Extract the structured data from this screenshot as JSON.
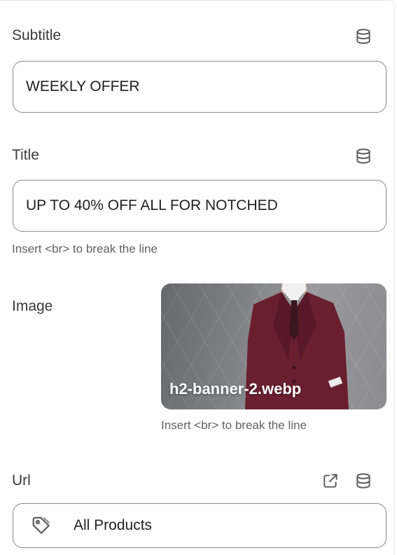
{
  "subtitle": {
    "label": "Subtitle",
    "value": "WEEKLY OFFER",
    "icon": "database-icon"
  },
  "title": {
    "label": "Title",
    "value": "UP TO 40%  OFF ALL FOR NOTCHED",
    "help": "Insert <br> to break the line",
    "icon": "database-icon"
  },
  "image": {
    "label": "Image",
    "filename": "h2-banner-2.webp",
    "help": "Insert <br> to break the line"
  },
  "url": {
    "label": "Url",
    "value": "All Products",
    "icons": [
      "external-link-icon",
      "database-icon",
      "tag-icon"
    ]
  },
  "colors": {
    "suit": "#6a1f2f",
    "border": "#8a8a8a",
    "help_text": "#616161"
  }
}
